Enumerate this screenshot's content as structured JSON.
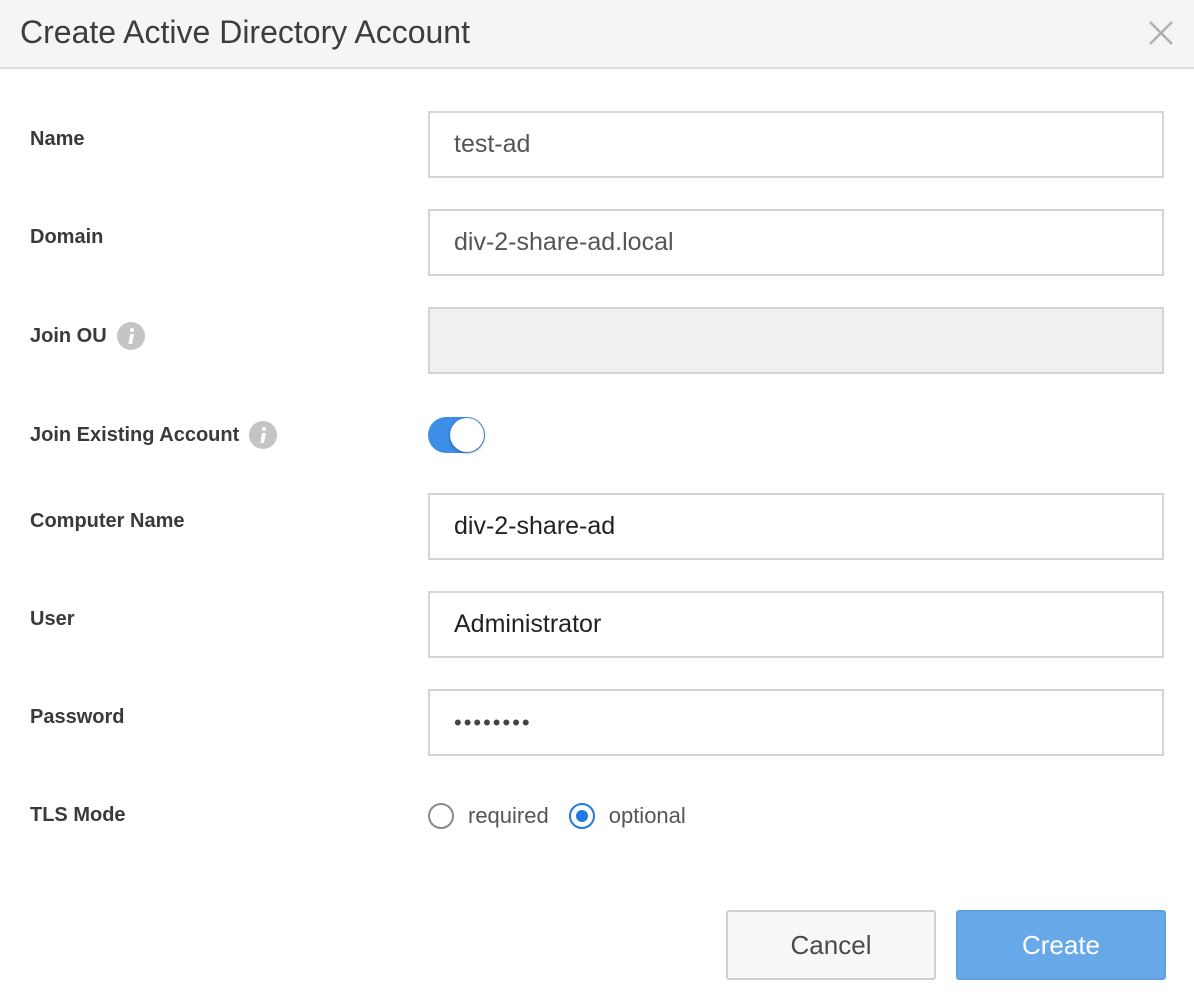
{
  "dialog": {
    "title": "Create Active Directory Account",
    "close_icon": "close-icon"
  },
  "form": {
    "name": {
      "label": "Name",
      "value": "test-ad"
    },
    "domain": {
      "label": "Domain",
      "value": "div-2-share-ad.local"
    },
    "join_ou": {
      "label": "Join OU",
      "value": "",
      "disabled": true,
      "icon": "info-icon"
    },
    "join_existing_account": {
      "label": "Join Existing Account",
      "enabled": true,
      "icon": "info-icon"
    },
    "computer_name": {
      "label": "Computer Name",
      "value": "div-2-share-ad"
    },
    "user": {
      "label": "User",
      "value": "Administrator"
    },
    "password": {
      "label": "Password",
      "value": "••••••••"
    },
    "tls_mode": {
      "label": "TLS Mode",
      "options": [
        {
          "label": "required",
          "checked": false
        },
        {
          "label": "optional",
          "checked": true
        }
      ]
    }
  },
  "buttons": {
    "cancel": "Cancel",
    "create": "Create"
  },
  "colors": {
    "accent": "#3d8ee6",
    "radio_selected": "#1f7ae6",
    "create_button": "#67a9e8"
  }
}
